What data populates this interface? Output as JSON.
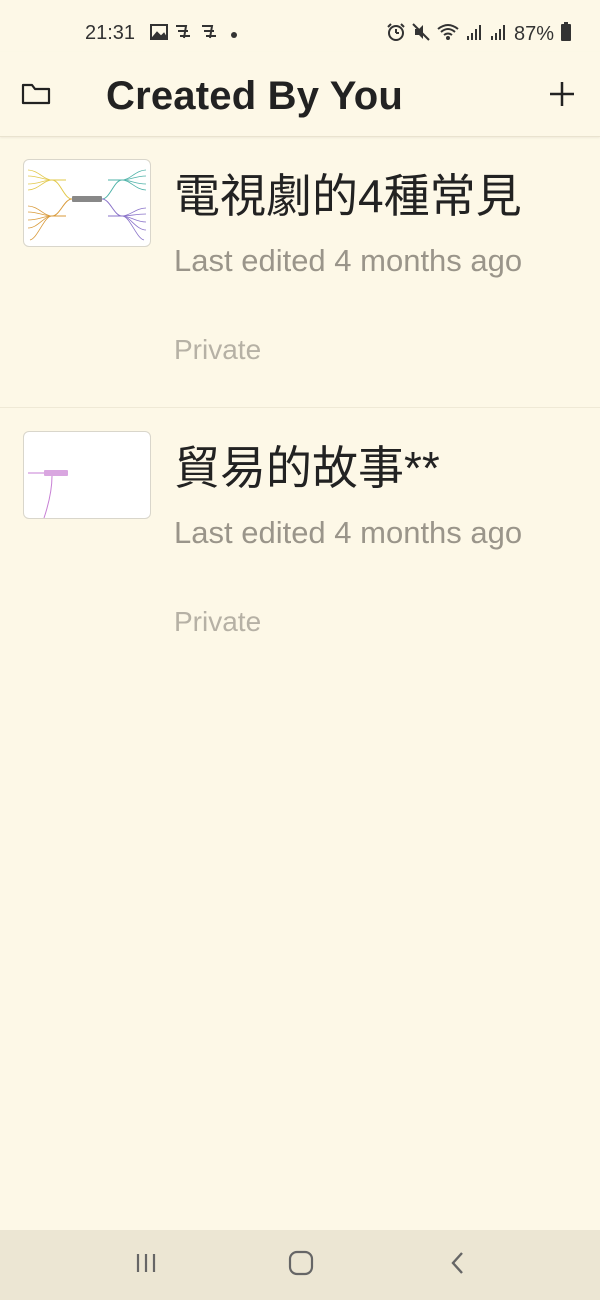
{
  "status_bar": {
    "time": "21:31",
    "battery": "87%",
    "left_icons": [
      "image-icon",
      "chinese-text-icon",
      "dot-icon"
    ],
    "right_icons": [
      "alarm-icon",
      "mute-icon",
      "wifi-icon",
      "signal-icon",
      "signal-icon",
      "battery-icon"
    ]
  },
  "app_bar": {
    "title": "Created By You",
    "left_icon": "folder-icon",
    "right_icon": "plus-icon"
  },
  "items": [
    {
      "title": "電視劇的4種常見",
      "meta": "Last edited 4 months ago",
      "privacy": "Private"
    },
    {
      "title": "貿易的故事**",
      "meta": "Last edited 4 months ago",
      "privacy": "Private"
    }
  ],
  "nav_bar": {
    "icons": [
      "recent-apps-icon",
      "home-icon",
      "back-icon"
    ]
  },
  "colors": {
    "background": "#fdf8e7",
    "title_text": "#222222",
    "secondary_text": "#9a958a",
    "nav_bar": "#ece6d3"
  }
}
